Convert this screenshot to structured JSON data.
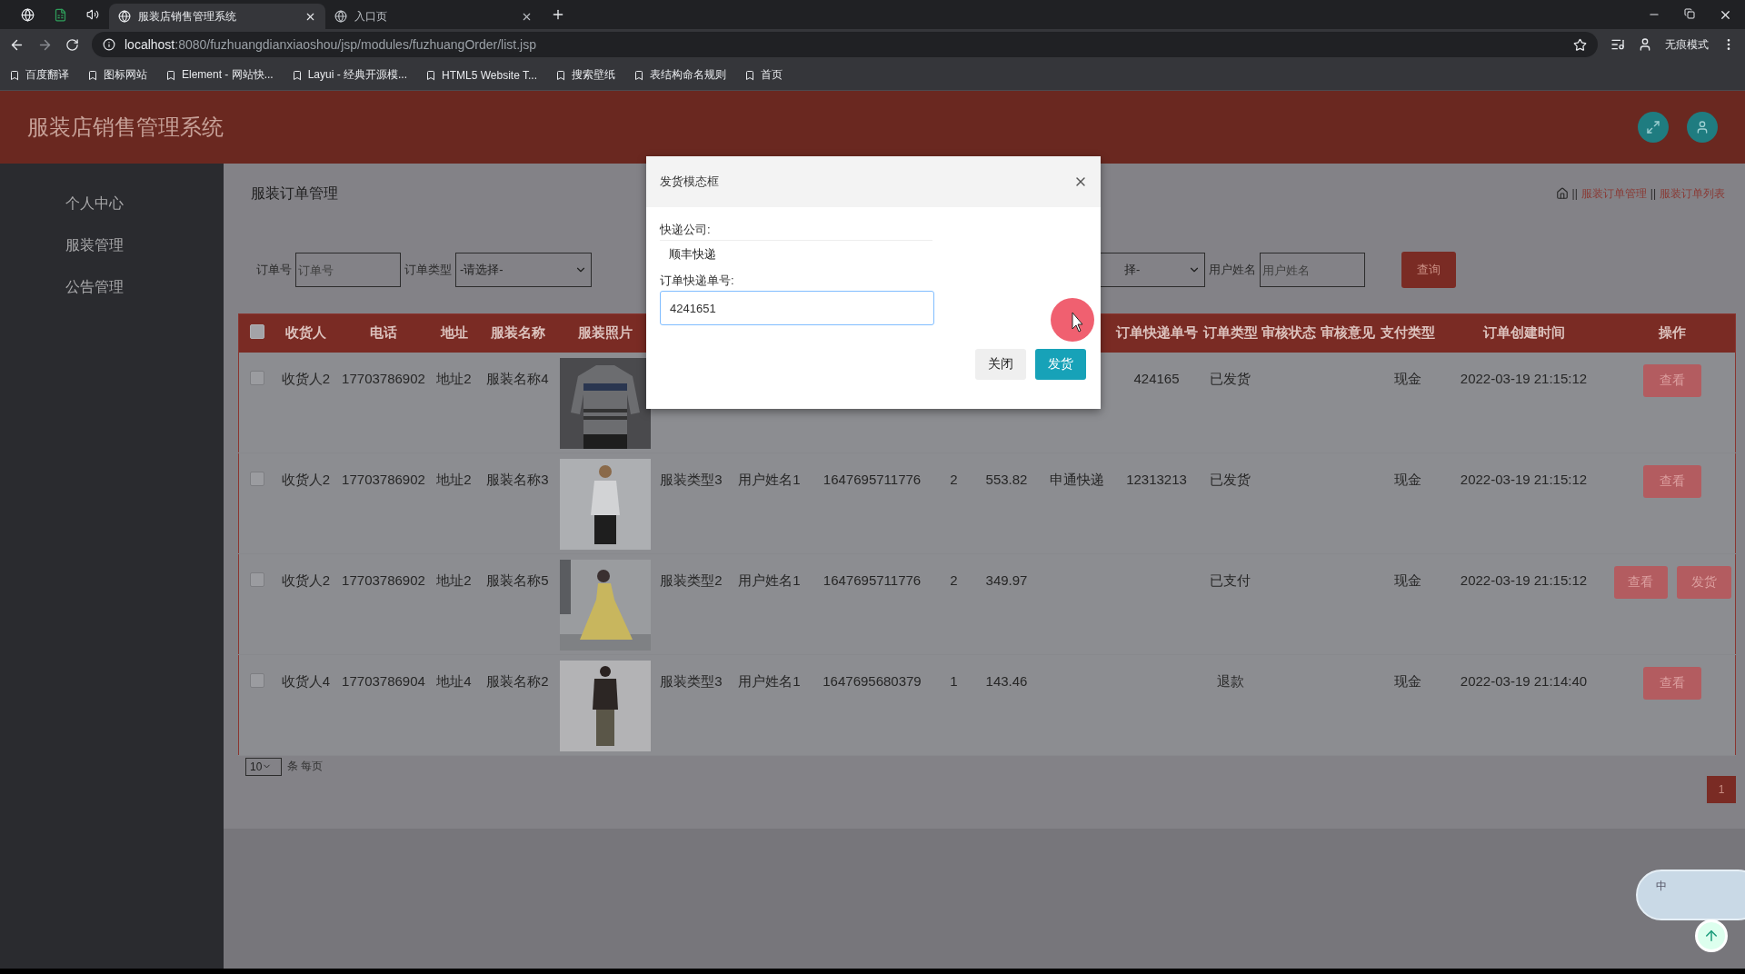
{
  "browser": {
    "tabs": [
      {
        "title": "服装店销售管理系统",
        "selected": true
      },
      {
        "title": "入口页",
        "selected": false
      }
    ],
    "url_host": "localhost",
    "url_path": ":8080/fuzhuangdianxiaoshou/jsp/modules/fuzhuangOrder/list.jsp",
    "profile_label": "无痕模式",
    "bookmarks": [
      "百度翻译",
      "图标网站",
      "Element - 网站快...",
      "Layui - 经典开源模...",
      "HTML5 Website T...",
      "搜索壁纸",
      "表结构命名规则",
      "首页"
    ]
  },
  "app": {
    "title": "服装店销售管理系统"
  },
  "sidebar": {
    "items": [
      "个人中心",
      "服装管理",
      "公告管理"
    ]
  },
  "page": {
    "title": "服装订单管理",
    "breadcrumb": [
      {
        "kind": "separator",
        "text": "||"
      },
      {
        "kind": "link",
        "text": "服装订单管理"
      },
      {
        "kind": "separator",
        "text": "||"
      },
      {
        "kind": "link",
        "text": "服装订单列表"
      }
    ]
  },
  "filters_left": [
    {
      "kind": "label",
      "text": "订单号"
    },
    {
      "kind": "input",
      "placeholder": "订单号"
    },
    {
      "kind": "label",
      "text": "订单类型"
    },
    {
      "kind": "select",
      "value": "-请选择-"
    }
  ],
  "filters_right": [
    {
      "kind": "select",
      "value": "择-"
    },
    {
      "kind": "label",
      "text": "用户姓名"
    },
    {
      "kind": "input",
      "placeholder": "用户姓名"
    },
    {
      "kind": "button",
      "text": "查询"
    }
  ],
  "table": {
    "header_checkbox": {
      "checked": false
    },
    "columns": [
      {
        "kind": "text",
        "label": "收货人"
      },
      {
        "kind": "text",
        "label": "电话"
      },
      {
        "kind": "text",
        "label": "地址"
      },
      {
        "kind": "text",
        "label": "服装名称"
      },
      {
        "label": "服装照片"
      },
      {
        "kind": "text"
      },
      {
        "kind": "text"
      },
      {
        "kind": "text"
      },
      {
        "kind": "text"
      },
      {
        "kind": "text"
      },
      {
        "kind": "text"
      },
      {
        "kind": "text",
        "label": "订单快递单号"
      },
      {
        "kind": "text",
        "label": "订单类型"
      },
      {
        "kind": "text",
        "label": "审核状态"
      },
      {
        "kind": "text",
        "label": "审核意见"
      },
      {
        "kind": "text",
        "label": "支付类型"
      },
      {
        "kind": "text",
        "label": "订单创建时间"
      },
      {
        "kind": "actions",
        "label": "操作"
      }
    ],
    "rows": [
      {
        "checked": false,
        "cells": [
          "收货人2",
          "17703786902",
          "地址2",
          "服装名称4",
          "",
          "",
          "",
          "",
          "",
          "",
          "",
          "424165",
          "已发货",
          "",
          "",
          "现金",
          "2022-03-19 21:15:12"
        ],
        "actions": [
          "查看"
        ]
      },
      {
        "checked": false,
        "cells": [
          "收货人2",
          "17703786902",
          "地址2",
          "服装名称3",
          "",
          "服装类型3",
          "用户姓名1",
          "1647695711776",
          "2",
          "553.82",
          "申通快递",
          "12313213",
          "已发货",
          "",
          "",
          "现金",
          "2022-03-19 21:15:12"
        ],
        "actions": [
          "查看"
        ]
      },
      {
        "checked": false,
        "cells": [
          "收货人2",
          "17703786902",
          "地址2",
          "服装名称5",
          "",
          "服装类型2",
          "用户姓名1",
          "1647695711776",
          "2",
          "349.97",
          "",
          "",
          "已支付",
          "",
          "",
          "现金",
          "2022-03-19 21:15:12"
        ],
        "actions": [
          "查看",
          "发货"
        ]
      },
      {
        "checked": false,
        "cells": [
          "收货人4",
          "17703786904",
          "地址4",
          "服装名称2",
          "",
          "服装类型3",
          "用户姓名1",
          "1647695680379",
          "1",
          "143.46",
          "",
          "",
          "退款",
          "",
          "",
          "现金",
          "2022-03-19 21:14:40"
        ],
        "actions": [
          "查看"
        ]
      }
    ]
  },
  "pagination": {
    "page_size": "10",
    "per_page_label": "条 每页",
    "pages": [
      {
        "label": "1",
        "selected": true
      }
    ]
  },
  "modal": {
    "title": "发货模态框",
    "fields": [
      {
        "kind": "text",
        "label": "快递公司:",
        "value": "顺丰快递"
      },
      {
        "kind": "input",
        "label": "订单快递单号:",
        "value": "4241651"
      }
    ],
    "buttons": [
      {
        "kind": "secondary",
        "text": "关闭"
      },
      {
        "kind": "primary",
        "text": "发货"
      }
    ]
  },
  "ime": {
    "label": "中"
  }
}
